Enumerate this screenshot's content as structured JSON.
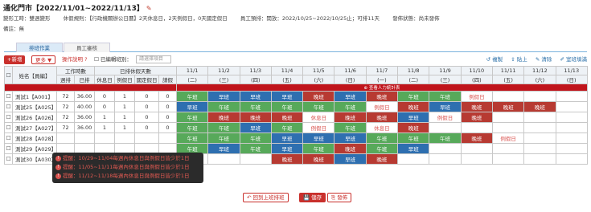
{
  "title": "通化門市【2022/11/01~2022/11/13】",
  "info": {
    "rotation": "變形工時：雙週變形",
    "rest_rule": "休假規則：【行政機關辦公日曆】2天休息日，2天例假日，0天國定假日",
    "pre_schedule": "員工預排：開放：2022/10/25~2022/10/25止；可排11天",
    "publish_status": "發佈狀態：尚未發佈",
    "remark": "備註：無"
  },
  "tabs": [
    "排班作業",
    "員工審核"
  ],
  "toolbar": {
    "new_label": "+新增",
    "more_label": "更多 ▼",
    "help_label": "操作說明",
    "edited_label": "已編輯班別：",
    "select_placeholder": "請選擇項目",
    "right_links": [
      "↺ 複製",
      "⇪ 貼上",
      "✎ 清除",
      "✐ 室班填滿"
    ]
  },
  "table": {
    "headers": {
      "name": "姓名【員編】",
      "work_days": "工作時數",
      "scheduled_days": "已排休假天數",
      "sub": [
        "週排",
        "已排",
        "休息日",
        "例假日",
        "國定假日",
        "請假"
      ]
    },
    "days": [
      {
        "d": "11/1",
        "w": "(二)"
      },
      {
        "d": "11/2",
        "w": "(三)"
      },
      {
        "d": "11/3",
        "w": "(四)"
      },
      {
        "d": "11/4",
        "w": "(五)"
      },
      {
        "d": "11/5",
        "w": "(六)"
      },
      {
        "d": "11/6",
        "w": "(日)"
      },
      {
        "d": "11/7",
        "w": "(一)"
      },
      {
        "d": "11/8",
        "w": "(二)"
      },
      {
        "d": "11/9",
        "w": "(三)"
      },
      {
        "d": "11/10",
        "w": "(四)"
      },
      {
        "d": "11/11",
        "w": "(五)"
      },
      {
        "d": "11/12",
        "w": "(六)"
      },
      {
        "d": "11/13",
        "w": "(日)"
      }
    ],
    "redbar_label": "⊕ 查看人力統計表",
    "rows": [
      {
        "name": "測試1【A001】",
        "warn": false,
        "vals": [
          "72",
          "36.00",
          "0",
          "1",
          "0",
          "0"
        ],
        "shifts": [
          [
            "m",
            "午班"
          ],
          [
            "w",
            "早班"
          ],
          [
            "w",
            "早班"
          ],
          [
            "w",
            "早班"
          ],
          [
            "n",
            "晚班"
          ],
          [
            "w",
            "早班"
          ],
          [
            "n",
            "晚班"
          ],
          [
            "m",
            "午班"
          ],
          [
            "m",
            "午班"
          ],
          [
            "r",
            "例假日"
          ],
          [
            "",
            ""
          ],
          [
            "",
            ""
          ],
          [
            "",
            ""
          ]
        ]
      },
      {
        "name": "測試25【A025】",
        "warn": false,
        "vals": [
          "72",
          "40.00",
          "0",
          "1",
          "0",
          "0"
        ],
        "shifts": [
          [
            "w",
            "早班"
          ],
          [
            "m",
            "午班"
          ],
          [
            "m",
            "午班"
          ],
          [
            "m",
            "午班"
          ],
          [
            "m",
            "午班"
          ],
          [
            "m",
            "午班"
          ],
          [
            "r",
            "例假日"
          ],
          [
            "n",
            "晚班"
          ],
          [
            "w",
            "早班"
          ],
          [
            "n",
            "晚班"
          ],
          [
            "n",
            "晚班"
          ],
          [
            "n",
            "晚班"
          ],
          [
            "",
            ""
          ]
        ]
      },
      {
        "name": "測試26【A026】",
        "warn": false,
        "vals": [
          "72",
          "36.00",
          "1",
          "1",
          "0",
          "0"
        ],
        "shifts": [
          [
            "m",
            "午班"
          ],
          [
            "n",
            "晚班"
          ],
          [
            "n",
            "晚班"
          ],
          [
            "n",
            "晚班"
          ],
          [
            "x",
            "休息日"
          ],
          [
            "n",
            "晚班"
          ],
          [
            "n",
            "晚班"
          ],
          [
            "w",
            "早班"
          ],
          [
            "r",
            "例假日"
          ],
          [
            "n",
            "晚班"
          ],
          [
            "",
            ""
          ],
          [
            "",
            ""
          ],
          [
            "",
            ""
          ]
        ]
      },
      {
        "name": "測試27【A027】",
        "warn": true,
        "vals": [
          "72",
          "36.00",
          "1",
          "1",
          "0",
          "0"
        ],
        "shifts": [
          [
            "m",
            "午班"
          ],
          [
            "m",
            "午班"
          ],
          [
            "w",
            "早班"
          ],
          [
            "m",
            "午班"
          ],
          [
            "r",
            "例假日"
          ],
          [
            "m",
            "午班"
          ],
          [
            "x",
            "休息日"
          ],
          [
            "n",
            "晚班"
          ],
          [
            "",
            ""
          ],
          [
            "",
            ""
          ],
          [
            "",
            ""
          ],
          [
            "",
            ""
          ],
          [
            "",
            ""
          ]
        ]
      },
      {
        "name": "測試28【A028】",
        "warn": true,
        "vals": [
          "",
          "",
          "",
          "",
          "",
          ""
        ],
        "shifts": [
          [
            "m",
            "午班"
          ],
          [
            "m",
            "午班"
          ],
          [
            "m",
            "午班"
          ],
          [
            "w",
            "早班"
          ],
          [
            "w",
            "早班"
          ],
          [
            "w",
            "早班"
          ],
          [
            "m",
            "午班"
          ],
          [
            "m",
            "午班"
          ],
          [
            "m",
            "午班"
          ],
          [
            "n",
            "晚班"
          ],
          [
            "r",
            "例假日"
          ],
          [
            "",
            ""
          ],
          [
            "",
            ""
          ]
        ]
      },
      {
        "name": "測試29【A029】",
        "warn": true,
        "vals": [
          "",
          "",
          "",
          "",
          "",
          ""
        ],
        "shifts": [
          [
            "m",
            "午班"
          ],
          [
            "w",
            "早班"
          ],
          [
            "m",
            "午班"
          ],
          [
            "w",
            "早班"
          ],
          [
            "m",
            "午班"
          ],
          [
            "n",
            "晚班"
          ],
          [
            "m",
            "午班"
          ],
          [
            "w",
            "早班"
          ],
          [
            "",
            ""
          ],
          [
            "",
            ""
          ],
          [
            "",
            ""
          ],
          [
            "",
            ""
          ],
          [
            "",
            ""
          ]
        ]
      },
      {
        "name": "測試30【A030】",
        "warn": false,
        "vals": [
          "",
          "",
          "",
          "",
          "",
          ""
        ],
        "shifts": [
          [
            "",
            ""
          ],
          [
            "",
            ""
          ],
          [
            "",
            ""
          ],
          [
            "n",
            "晚班"
          ],
          [
            "n",
            "晚班"
          ],
          [
            "w",
            "早班"
          ],
          [
            "n",
            "晚班"
          ],
          [
            "",
            ""
          ],
          [
            "",
            ""
          ],
          [
            "",
            ""
          ],
          [
            "",
            ""
          ],
          [
            "",
            ""
          ],
          [
            "",
            ""
          ]
        ]
      }
    ]
  },
  "tooltip": {
    "lines": [
      "提醒：10/29~11/04每週內休息日與例假日皆少於1日",
      "提醒：11/05~11/11每週內休息日與例假日皆少於1日",
      "提醒：11/12~11/18每週內休息日與例假日皆少於1日"
    ]
  },
  "footer": {
    "back_label": "↶ 回到上班排班",
    "save_label": "💾 儲存",
    "publish_label": "⎘ 發佈"
  }
}
